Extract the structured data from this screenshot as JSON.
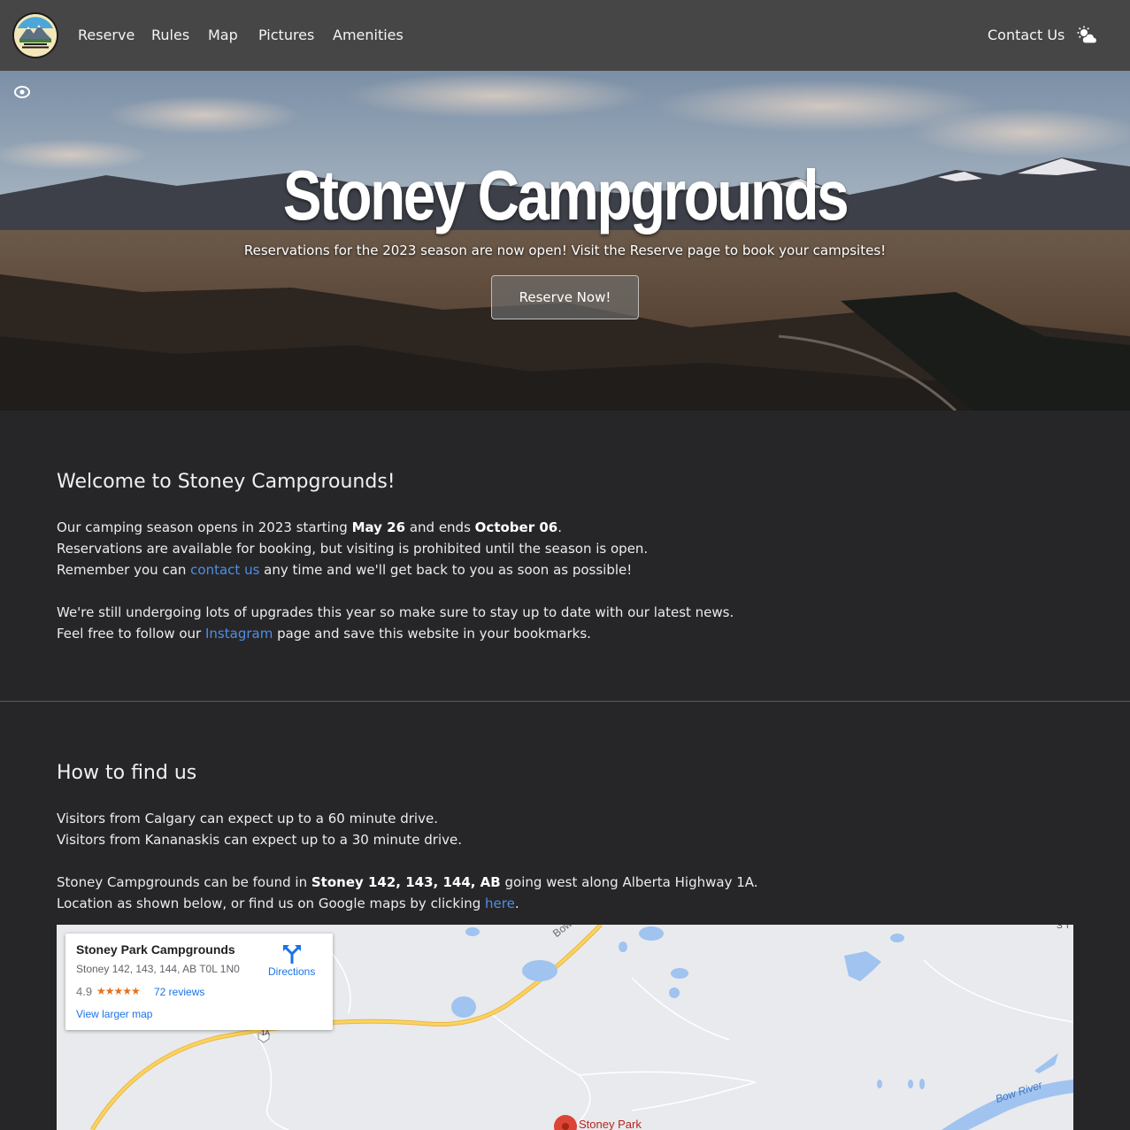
{
  "nav": {
    "items": [
      "Reserve",
      "Rules",
      "Map",
      "Pictures",
      "Amenities"
    ],
    "contact": "Contact Us",
    "icons": {
      "weather": "weather-cloud-sun-icon",
      "visibility": "eye-icon"
    }
  },
  "hero": {
    "title": "Stoney Campgrounds",
    "subtitle": "Reservations for the 2023 season are now open! Visit the Reserve page to book your campsites!",
    "button": "Reserve Now!"
  },
  "welcome": {
    "heading": "Welcome to Stoney Campgrounds!",
    "p1_a": "Our camping season opens in 2023 starting ",
    "p1_start": "May 26",
    "p1_b": " and ends ",
    "p1_end": "October 06",
    "p1_c": ".",
    "p2": "Reservations are available for booking, but visiting is prohibited until the season is open.",
    "p3_a": "Remember you can ",
    "p3_link": "contact us",
    "p3_b": " any time and we'll get back to you as soon as possible!",
    "p4": "We're still undergoing lots of upgrades this year so make sure to stay up to date with our latest news.",
    "p5_a": "Feel free to follow our ",
    "p5_link": "Instagram",
    "p5_b": " page and save this website in your bookmarks."
  },
  "find": {
    "heading": "How to find us",
    "p1": "Visitors from Calgary can expect up to a 60 minute drive.",
    "p2": "Visitors from Kananaskis can expect up to a 30 minute drive.",
    "p3_a": "Stoney Campgrounds can be found in ",
    "p3_bold": "Stoney 142, 143, 144, AB",
    "p3_b": " going west along Alberta Highway 1A.",
    "p4_a": "Location as shown below, or find us on Google maps by clicking ",
    "p4_link": "here",
    "p4_b": "."
  },
  "map": {
    "place": "Stoney Park Campgrounds",
    "address": "Stoney 142, 143, 144, AB T0L 1N0",
    "rating": "4.9",
    "stars": "★★★★★",
    "reviews": "72 reviews",
    "directions": "Directions",
    "larger": "View larger map",
    "labels": {
      "bow_valley": "Bow Va...",
      "bow_river": "Bow River",
      "marker": "Stoney Park",
      "highway": "1A",
      "corner": "S T"
    }
  },
  "colors": {
    "nav_bg": "#464646",
    "page_bg": "#262628",
    "link": "#4d8fe6"
  }
}
